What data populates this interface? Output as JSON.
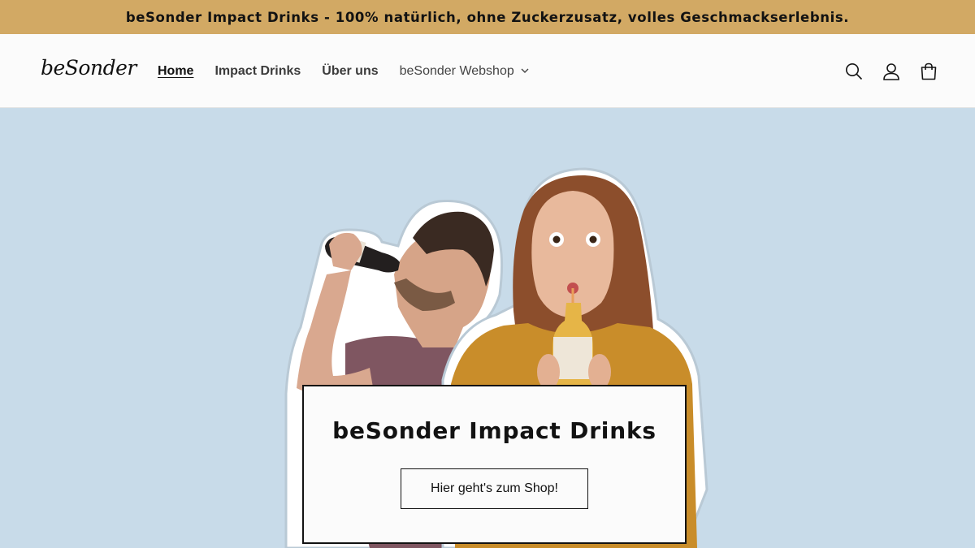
{
  "announcement": {
    "text": "beSonder Impact Drinks - 100% natürlich, ohne Zuckerzusatz, volles Geschmackserlebnis."
  },
  "header": {
    "logo_text": "beSonder",
    "nav": {
      "home": "Home",
      "impact_drinks": "Impact Drinks",
      "about": "Über uns",
      "webshop": "beSonder Webshop"
    },
    "icons": [
      "search-icon",
      "account-icon",
      "cart-icon"
    ]
  },
  "hero": {
    "title": "beSonder Impact Drinks",
    "button_label": "Hier geht's zum Shop!"
  },
  "colors": {
    "announcement_bg": "#d2a964",
    "hero_bg": "#c8dbe9",
    "header_bg": "#fbfbfb",
    "text": "#121212"
  }
}
